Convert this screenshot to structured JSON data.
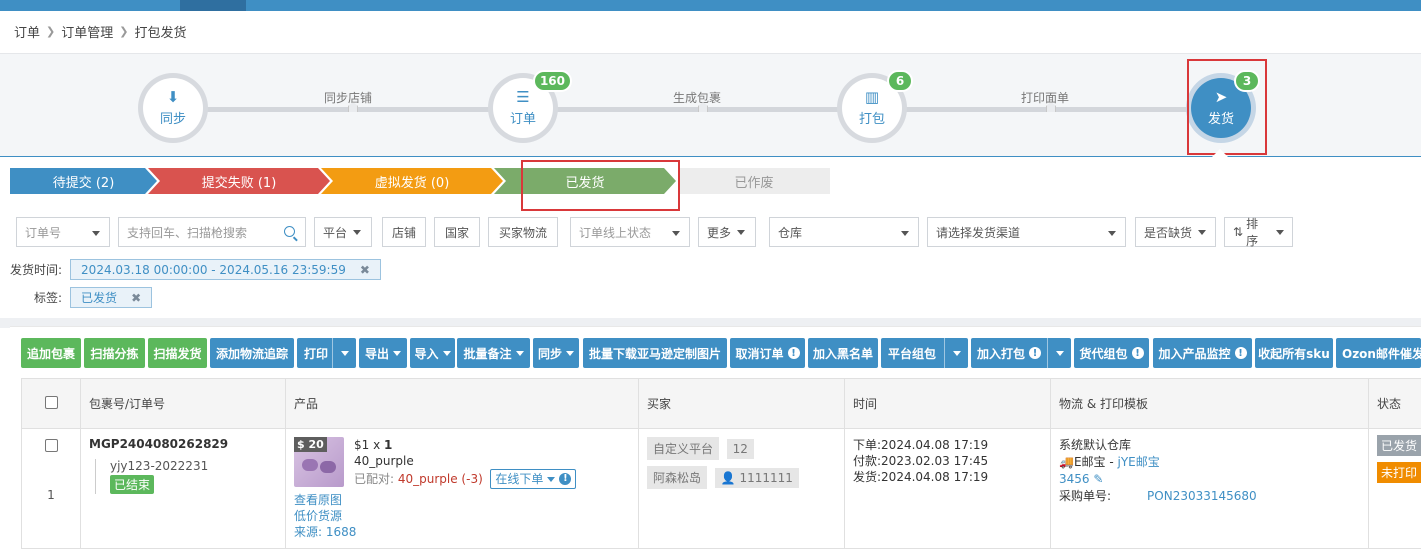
{
  "breadcrumb": {
    "items": [
      "订单",
      "订单管理",
      "打包发货"
    ]
  },
  "flow": {
    "steps": [
      {
        "label": "同步",
        "icon": "download-icon",
        "badge": ""
      },
      {
        "label": "订单",
        "icon": "list-icon",
        "badge": "160"
      },
      {
        "label": "打包",
        "icon": "barcode-icon",
        "badge": "6"
      },
      {
        "label": "发货",
        "icon": "paper-plane-icon",
        "badge": "3"
      }
    ],
    "connectors": [
      "同步店铺",
      "生成包裹",
      "打印面单"
    ],
    "active_step": "发货"
  },
  "status_tabs": [
    {
      "label": "待提交 (2)",
      "color": "#3f8fc4"
    },
    {
      "label": "提交失败 (1)",
      "color": "#d9534f"
    },
    {
      "label": "虚拟发货 (0)",
      "color": "#f39c12"
    },
    {
      "label": "已发货",
      "color": "#7bab6a"
    },
    {
      "label": "已作废",
      "color": "#ededed"
    }
  ],
  "filters": {
    "order_no": "订单号",
    "search_placeholder": "支持回车、扫描枪搜索",
    "platform": "平台",
    "store": "店铺",
    "country": "国家",
    "buyer_logistics": "买家物流",
    "online_status": "订单线上状态",
    "more": "更多",
    "warehouse": "仓库",
    "channel": "请选择发货渠道",
    "out_of_stock": "是否缺货",
    "sort": "排序"
  },
  "active_filters": {
    "ship_time_label": "发货时间:",
    "ship_time_value": "2024.03.18 00:00:00 - 2024.05.16 23:59:59",
    "tag_label": "标签:",
    "tag_value": "已发货"
  },
  "toolbar": {
    "add_package": "追加包裹",
    "scan_sort": "扫描分拣",
    "scan_ship": "扫描发货",
    "add_tracking": "添加物流追踪",
    "print": "打印",
    "export": "导出",
    "import": "导入",
    "batch_note": "批量备注",
    "sync": "同步",
    "batch_download_amazon": "批量下载亚马逊定制图片",
    "cancel_order": "取消订单",
    "add_blacklist": "加入黑名单",
    "platform_group": "平台组包",
    "add_pack": "加入打包",
    "agent_group": "货代组包",
    "add_product_monitor": "加入产品监控",
    "collapse_sku": "收起所有sku",
    "ozon_mail": "Ozon邮件催发"
  },
  "table": {
    "headers": [
      "包裹号/订单号",
      "产品",
      "买家",
      "时间",
      "物流 & 打印模板",
      "状态"
    ],
    "rows": [
      {
        "index": "1",
        "package_no": "MGP2404080262829",
        "order_no": "yjy123-2022231",
        "order_status": "已结束",
        "product": {
          "price_badge": "$ 20",
          "price_qty_prefix": "$1 x ",
          "qty": "1",
          "variant": "40_purple",
          "matched_label": "已配对: ",
          "matched_value": "40_purple (-3)",
          "online_order": "在线下单",
          "view_image": "查看原图",
          "low_price_source": "低价货源",
          "source": "来源: 1688"
        },
        "buyer": {
          "platform": "自定义平台",
          "count": "12",
          "name": "阿森松岛",
          "user": "1111111"
        },
        "time": {
          "order": "下单:2024.04.08 17:19",
          "paid": "付款:2023.02.03 17:45",
          "shipped": "发货:2024.04.08 17:19"
        },
        "logistics": {
          "warehouse": "系统默认仓库",
          "carrier_prefix": "E邮宝 - ",
          "carrier_link": "jYE邮宝",
          "tracking": "3456",
          "purchase_label": "采购单号:",
          "purchase_no": "PON23033145680"
        },
        "status": {
          "shipped": "已发货",
          "unprinted": "未打印"
        }
      }
    ]
  }
}
